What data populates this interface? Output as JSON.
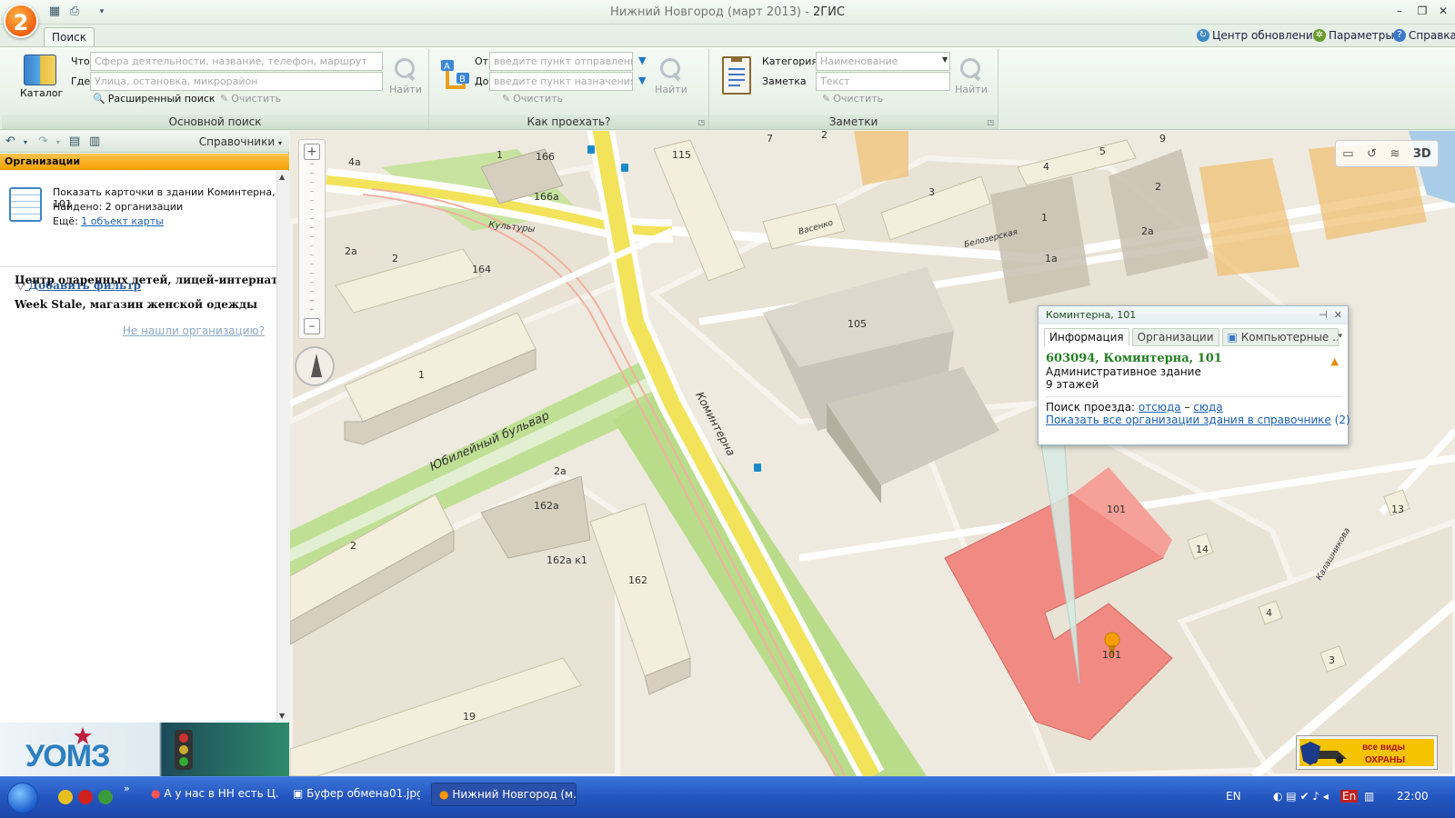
{
  "window": {
    "title_prefix": "Нижний Новгород (март 2013) - ",
    "app_name": "2ГИС",
    "logo_char": "2"
  },
  "tabs": {
    "search": "Поиск"
  },
  "toplinks": {
    "updates": "Центр обновлений",
    "params": "Параметры",
    "help": "Справка"
  },
  "main_search": {
    "catalog_label": "Каталог",
    "what_label": "Что",
    "what_placeholder": "Сфера деятельности, название, телефон, маршрут",
    "where_label": "Где",
    "where_placeholder": "Улица, остановка, микрорайон",
    "find_label": "Найти",
    "advanced": "Расширенный поиск",
    "clear": "Очистить",
    "group_label": "Основной поиск"
  },
  "route": {
    "from_label": "От",
    "from_placeholder": "введите пункт отправления",
    "to_label": "До",
    "to_placeholder": "введите пункт назначения",
    "find_label": "Найти",
    "clear": "Очистить",
    "group_label": "Как проехать?"
  },
  "notes": {
    "category_label": "Категория",
    "category_placeholder": "Наименование",
    "note_label": "Заметка",
    "note_placeholder": "Текст",
    "find_label": "Найти",
    "clear": "Очистить",
    "group_label": "Заметки"
  },
  "left": {
    "directories": "Справочники",
    "header": "Организации",
    "show_cards": "Показать карточки в здании Коминтерна, 101",
    "found": "Найдено: 2 организации",
    "more_prefix": "Ещё:",
    "more_link": "1 объект карты",
    "add_filter": "Добавить фильтр",
    "orgs": [
      "Центр одаренных детей, лицей-интернат",
      "Week Stale, магазин женской одежды"
    ],
    "not_found": "Не нашли организацию?",
    "banner_text": "УОМЗ"
  },
  "map": {
    "labels": [
      {
        "t": "166"
      },
      {
        "t": "166а"
      },
      {
        "t": "115"
      },
      {
        "t": "1"
      },
      {
        "t": "4а"
      },
      {
        "t": "2а"
      },
      {
        "t": "2"
      },
      {
        "t": "164"
      },
      {
        "t": "1"
      },
      {
        "t": "105"
      },
      {
        "t": "2а"
      },
      {
        "t": "162а"
      },
      {
        "t": "162а к1"
      },
      {
        "t": "162"
      },
      {
        "t": "2"
      },
      {
        "t": "19"
      },
      {
        "t": "101"
      },
      {
        "t": "101"
      },
      {
        "t": "14"
      },
      {
        "t": "13"
      },
      {
        "t": "4"
      },
      {
        "t": "3"
      },
      {
        "t": "7"
      },
      {
        "t": "2"
      },
      {
        "t": "3"
      },
      {
        "t": "5"
      },
      {
        "t": "9"
      },
      {
        "t": "4"
      },
      {
        "t": "1"
      },
      {
        "t": "2"
      },
      {
        "t": "2а"
      },
      {
        "t": "1а"
      }
    ],
    "streets": {
      "kultury": "Культуры",
      "yubileyny": "Юбилейный бульвар",
      "kominterna": "Коминтерна",
      "belozerskaya": "Белозерская",
      "vasenko": "Васенко",
      "kalashnikova": "Калашникова"
    },
    "control_3d": "3D",
    "ad_line1": "все виды",
    "ad_line2": "ОХРАНЫ"
  },
  "popup": {
    "title": "Коминтерна, 101",
    "tabs": [
      "Информация",
      "Организации",
      "Компьютерные ..."
    ],
    "address": "603094, Коминтерна, 101",
    "type": "Административное здание",
    "floors": "9 этажей",
    "route_prefix": "Поиск проезда:",
    "route_from": "отсюда",
    "route_sep": "–",
    "route_to": "сюда",
    "show_all": "Показать все организации здания в справочнике",
    "show_all_count": "(2)"
  },
  "taskbar": {
    "items": [
      "А у нас в НН есть Ц...",
      "Буфер обмена01.jpg...",
      "Нижний Новгород (м..."
    ],
    "lang": "EN",
    "clock": "22:00"
  },
  "colors": {
    "accent_orange": "#f5a000",
    "target_building": "#f08a82",
    "road_yellow": "#f2e35a"
  }
}
